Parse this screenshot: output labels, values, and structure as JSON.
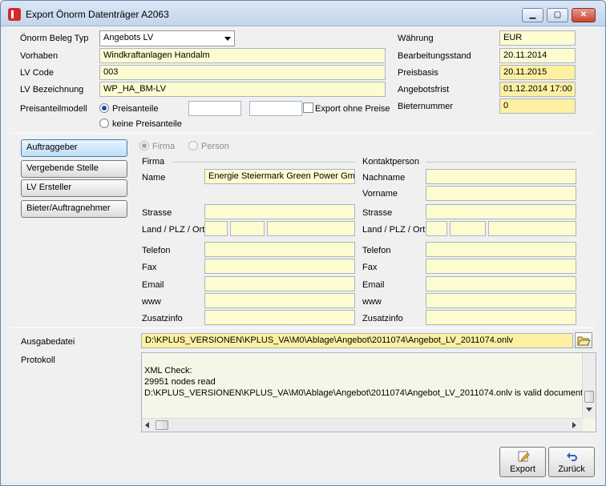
{
  "window": {
    "title": "Export Önorm Datenträger A2063"
  },
  "header": {
    "beleg_typ_label": "Önorm Beleg Typ",
    "beleg_typ_value": "Angebots LV",
    "vorhaben_label": "Vorhaben",
    "vorhaben_value": "Windkraftanlagen Handalm",
    "lv_code_label": "LV Code",
    "lv_code_value": "003",
    "lv_bez_label": "LV Bezeichnung",
    "lv_bez_value": "WP_HA_BM-LV",
    "preisanteil_label": "Preisanteilmodell",
    "radio_preisanteile": "Preisanteile",
    "radio_keine": "keine Preisanteile",
    "export_ohne_preise": "Export ohne Preise",
    "waehrung_label": "Währung",
    "waehrung_value": "EUR",
    "bearbeitungsstand_label": "Bearbeitungsstand",
    "bearbeitungsstand_value": "20.11.2014",
    "preisbasis_label": "Preisbasis",
    "preisbasis_value": "20.11.2015",
    "angebotsfrist_label": "Angebotsfrist",
    "angebotsfrist_value": "01.12.2014  17:00",
    "bieternummer_label": "Bieternummer",
    "bieternummer_value": "0"
  },
  "sidebar": {
    "items": [
      {
        "label": "Auftraggeber"
      },
      {
        "label": "Vergebende Stelle"
      },
      {
        "label": "LV Ersteller"
      },
      {
        "label": "Bieter/Auftragnehmer"
      }
    ]
  },
  "entity": {
    "radio_firma": "Firma",
    "radio_person": "Person",
    "firma_group": "Firma",
    "kontakt_group": "Kontaktperson",
    "name_label": "Name",
    "name_value": "Energie Steiermark Green Power Gmb",
    "nachname_label": "Nachname",
    "vorname_label": "Vorname",
    "strasse_label": "Strasse",
    "land_label": "Land / PLZ / Ort",
    "telefon_label": "Telefon",
    "fax_label": "Fax",
    "email_label": "Email",
    "www_label": "www",
    "zusatz_label": "Zusatzinfo"
  },
  "output": {
    "ausgabedatei_label": "Ausgabedatei",
    "ausgabedatei_value": "D:\\KPLUS_VERSIONEN\\KPLUS_VA\\M0\\Ablage\\Angebot\\2011074\\Angebot_LV_2011074.onlv",
    "protokoll_label": "Protokoll",
    "protokoll_lines": "XML Check:\n29951 nodes read\nD:\\KPLUS_VERSIONEN\\KPLUS_VA\\M0\\Ablage\\Angebot\\2011074\\Angebot_LV_2011074.onlv is valid document"
  },
  "buttons": {
    "export": "Export",
    "zurueck": "Zurück"
  },
  "colors": {
    "required_field": "#fdf0a3",
    "input_field": "#fdfbd0",
    "accent": "#1a4fa3"
  },
  "icons": [
    "app-logo-icon",
    "minimize-icon",
    "maximize-icon",
    "close-icon",
    "folder-open-icon",
    "pencil-icon",
    "undo-arrow-icon"
  ]
}
